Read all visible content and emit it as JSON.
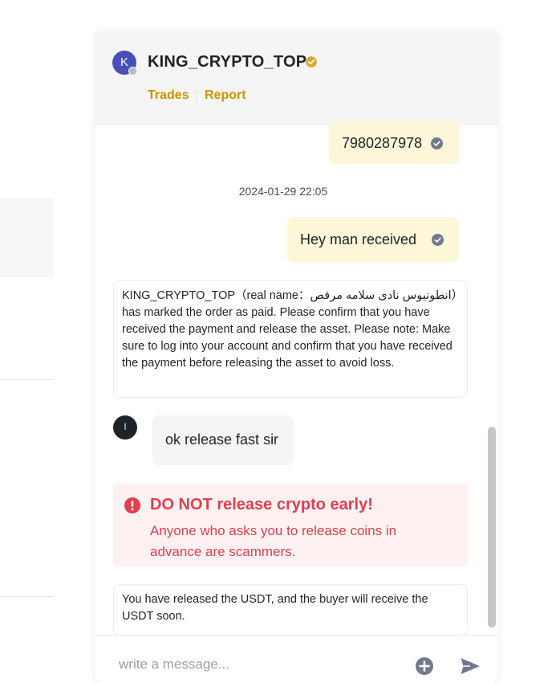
{
  "chat": {
    "user": {
      "avatar_initial": "K",
      "username": "KING_CRYPTO_TOP"
    },
    "links": {
      "trades": "Trades",
      "report": "Report"
    },
    "messages": {
      "out1": "7980287978",
      "timestamp": "2024-01-29 22:05",
      "out2": "Hey man received",
      "system1": "KING_CRYPTO_TOP（real name：انطونيوس نادى سلامه مرقص）has marked the order as paid. Please confirm that you have received the payment and release the asset. Please note: Make sure to log into your account and confirm that you have received the payment before releasing the asset to avoid loss.",
      "peer_avatar_initial": "ا",
      "in1": "ok release fast sir",
      "warning_title": "DO NOT release crypto early!",
      "warning_body": "Anyone who asks you to release coins in advance are scammers.",
      "system2": "You have released the USDT, and the buyer will receive the USDT soon."
    },
    "composer": {
      "placeholder": "write a message..."
    },
    "colors": {
      "accent": "#c99400",
      "warning": "#e0404f",
      "outgoing_bubble": "#fdf6d8"
    }
  }
}
